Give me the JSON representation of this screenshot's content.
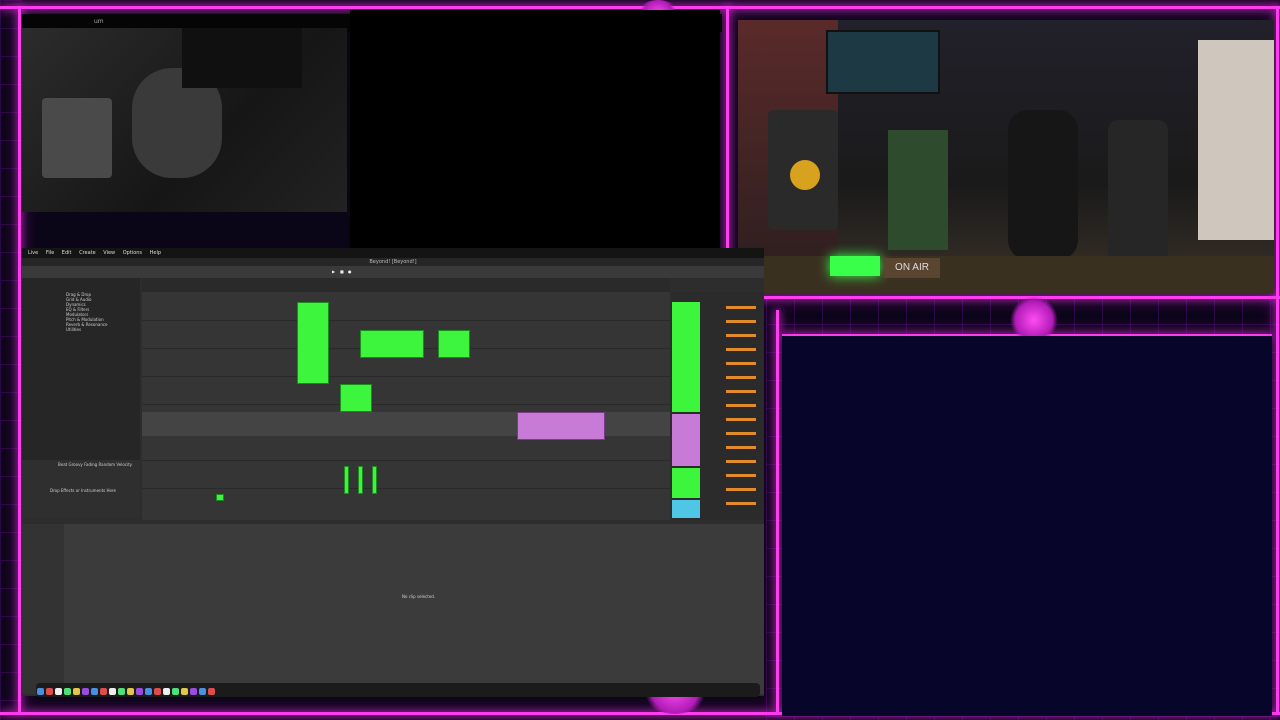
{
  "top_bar": {
    "title": "um"
  },
  "daw": {
    "menu": [
      "Live",
      "File",
      "Edit",
      "Create",
      "View",
      "Options",
      "Help"
    ],
    "window_title": "Beyond! [Beyond!]",
    "browser_items": [
      "Drag & Drop",
      "Grid & Audio",
      "Dynamics",
      "EQ & Filters",
      "Modulators",
      "Pitch & Modulation",
      "Reverb & Resonance",
      "Utilities"
    ],
    "device_tabs": [
      "Beat",
      "Groovy",
      "Fading",
      "Random",
      "Velocity"
    ],
    "no_clip_text": "No clip selected.",
    "status_hint": "Drop Effects or Instruments Here"
  },
  "camera": {
    "sign_text": "ON AIR"
  },
  "colors": {
    "neon": "#ff3df0",
    "clip_green": "#3df53d",
    "clip_purple": "#c77bd6"
  }
}
